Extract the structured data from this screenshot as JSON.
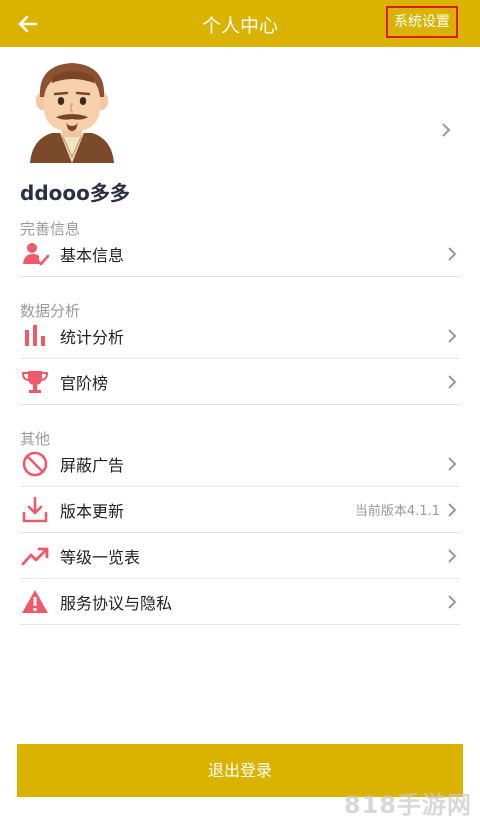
{
  "header": {
    "title": "个人中心",
    "settings_label": "系统设置"
  },
  "profile": {
    "username": "ddooo多多"
  },
  "sections": [
    {
      "title": "完善信息",
      "items": [
        {
          "label": "基本信息",
          "icon": "user-check-icon"
        }
      ]
    },
    {
      "title": "数据分析",
      "items": [
        {
          "label": "统计分析",
          "icon": "bar-chart-icon"
        },
        {
          "label": "官阶榜",
          "icon": "trophy-icon"
        }
      ]
    },
    {
      "title": "其他",
      "items": [
        {
          "label": "屏蔽广告",
          "icon": "block-icon"
        },
        {
          "label": "版本更新",
          "icon": "download-icon",
          "extra": "当前版本4.1.1"
        },
        {
          "label": "等级一览表",
          "icon": "trend-up-icon"
        },
        {
          "label": "服务协议与隐私",
          "icon": "warning-icon"
        }
      ]
    }
  ],
  "logout_label": "退出登录",
  "watermark": "818手游网",
  "colors": {
    "header": "#D9B300",
    "accent": "#ef5a6b"
  }
}
